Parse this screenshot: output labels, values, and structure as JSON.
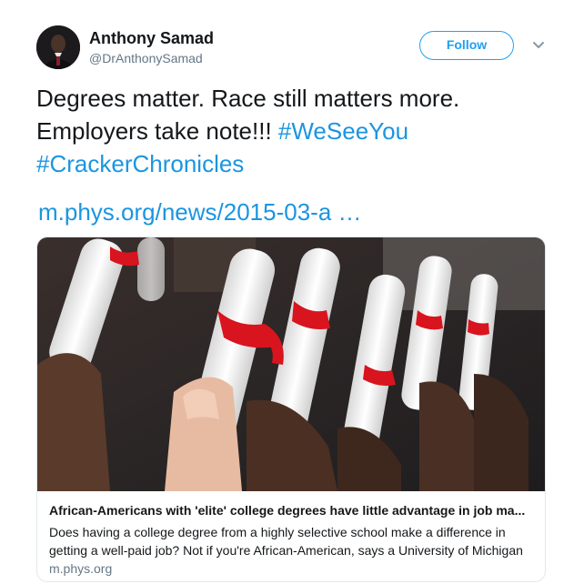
{
  "author": {
    "name": "Anthony Samad",
    "handle": "@DrAnthonySamad",
    "follow_label": "Follow"
  },
  "tweet": {
    "text": "Degrees matter. Race still matters more. Employers take note!!! ",
    "hashtags": [
      "#WeSeeYou",
      "#CrackerChronicles"
    ],
    "link": "m.phys.org/news/2015-03-a …"
  },
  "card": {
    "title": "African-Americans with 'elite' college degrees have little advantage in job ma...",
    "description": "Does having a college degree from a highly selective school make a difference in getting a well-paid job? Not if you're African-American, says a University of Michigan",
    "domain": "m.phys.org"
  },
  "colors": {
    "accent": "#1da1f2",
    "link": "#1b95e0",
    "secondary_text": "#657786"
  },
  "icons": {
    "more_menu": "chevron-down-icon",
    "avatar": "user-avatar"
  }
}
